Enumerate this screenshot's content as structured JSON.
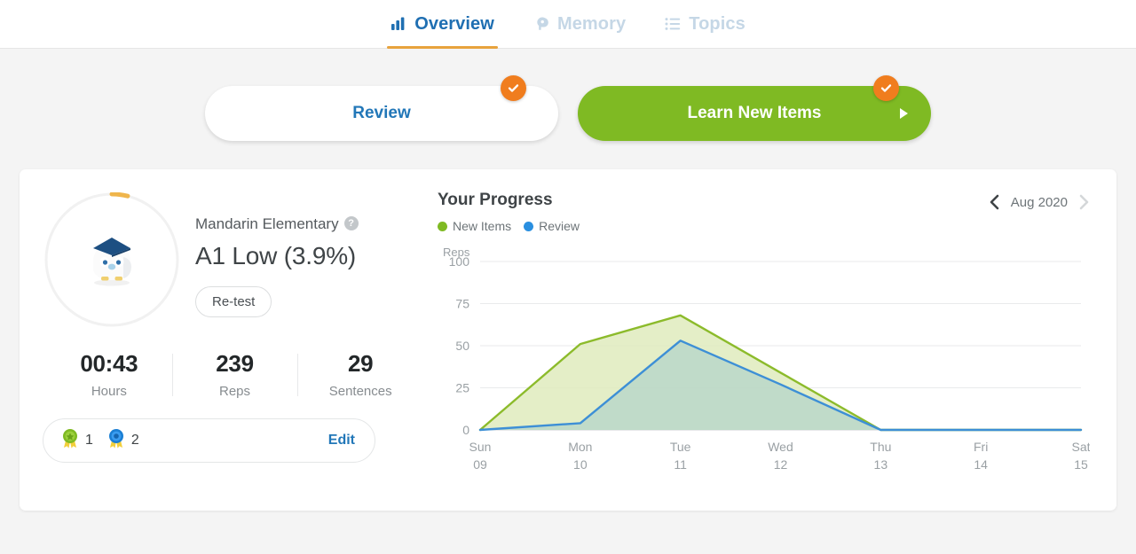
{
  "nav": {
    "tabs": [
      {
        "label": "Overview",
        "icon": "bar-chart-icon",
        "active": true
      },
      {
        "label": "Memory",
        "icon": "head-brain-icon",
        "active": false
      },
      {
        "label": "Topics",
        "icon": "list-icon",
        "active": false
      }
    ],
    "active_underline_color": "#e8a33d",
    "active_color": "#1f6fb2",
    "inactive_color": "#c5d7e6"
  },
  "actions": {
    "review": {
      "label": "Review",
      "badge": "check-icon",
      "badge_color": "#f07d1e",
      "text_color": "#2277b8"
    },
    "learn": {
      "label": "Learn New Items",
      "badge": "check-icon",
      "badge_color": "#f07d1e",
      "bg_color": "#7fba23",
      "arrow": "play-arrow-icon"
    }
  },
  "profile": {
    "avatar": "penguin-graduate-avatar",
    "progress_percent": 3.9,
    "ring_color": "#efb54c",
    "ring_track_color": "#f0f0f0",
    "course_name": "Mandarin Elementary",
    "help_icon": "question-mark-icon",
    "level": "A1 Low (3.9%)",
    "retest_label": "Re-test"
  },
  "stats": [
    {
      "value": "00:43",
      "label": "Hours"
    },
    {
      "value": "239",
      "label": "Reps"
    },
    {
      "value": "29",
      "label": "Sentences"
    }
  ],
  "badges": {
    "items": [
      {
        "icon": "green-star-medal-icon",
        "color": "#7fba23",
        "count": "1"
      },
      {
        "icon": "blue-circle-medal-icon",
        "color": "#2a8fe0",
        "count": "2"
      }
    ],
    "edit_label": "Edit"
  },
  "progress_panel": {
    "title": "Your Progress",
    "month": "Aug 2020",
    "prev_icon": "chevron-left-icon",
    "next_icon": "chevron-right-icon",
    "prev_enabled": true,
    "next_enabled": false
  },
  "chart_data": {
    "type": "area",
    "title": "Your Progress",
    "xlabel": "",
    "ylabel": "Reps",
    "ylim": [
      0,
      100
    ],
    "yticks": [
      0,
      25,
      50,
      75,
      100
    ],
    "grid": true,
    "legend_position": "top-left",
    "categories": [
      "Sun",
      "Mon",
      "Tue",
      "Wed",
      "Thu",
      "Fri",
      "Sat"
    ],
    "category_dates": [
      "09",
      "10",
      "11",
      "12",
      "13",
      "14",
      "15"
    ],
    "series": [
      {
        "name": "New Items",
        "color": "#8cbb2b",
        "fill": "#dfebbd",
        "values": [
          0,
          51,
          68,
          34,
          0,
          0,
          0
        ]
      },
      {
        "name": "Review",
        "color": "#3d8fd6",
        "fill": "#a9ceca",
        "values": [
          0,
          4,
          53,
          27,
          0,
          0,
          0
        ]
      }
    ]
  }
}
